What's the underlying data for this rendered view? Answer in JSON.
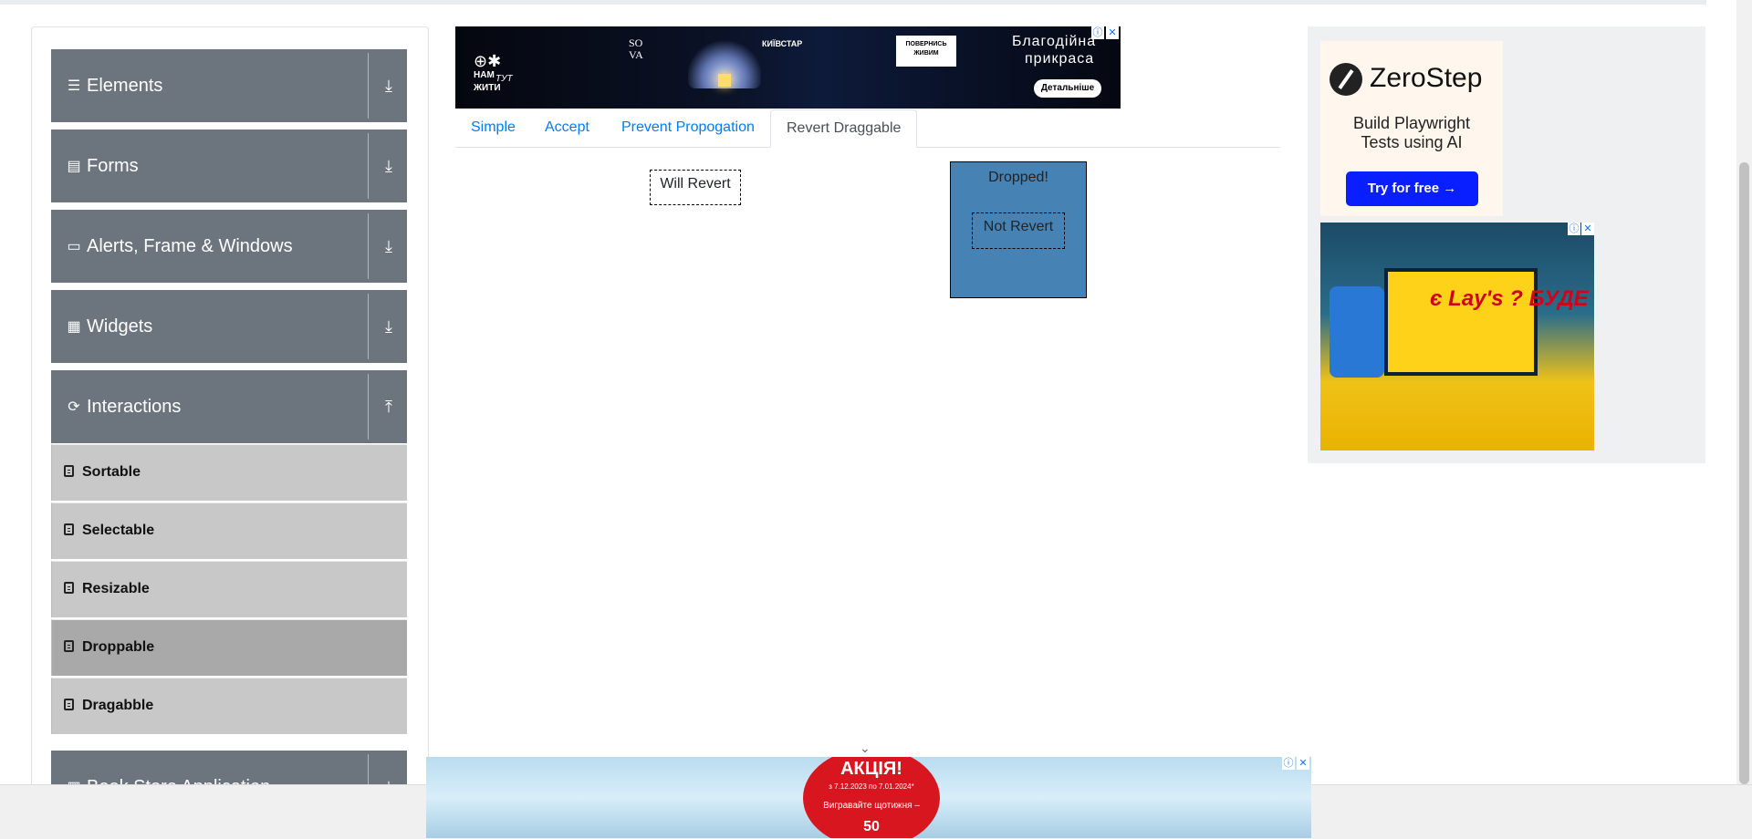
{
  "sidebar": {
    "groups": [
      {
        "label": "Elements",
        "icon": "hamburger-icon",
        "arrow": "download-icon"
      },
      {
        "label": "Forms",
        "icon": "file-icon",
        "arrow": "download-icon"
      },
      {
        "label": "Alerts, Frame & Windows",
        "icon": "window-icon",
        "arrow": "download-icon"
      },
      {
        "label": "Widgets",
        "icon": "widgets-grid-icon",
        "arrow": "download-icon"
      },
      {
        "label": "Interactions",
        "icon": "refresh-icon",
        "arrow": "upload-icon"
      },
      {
        "label": "Book Store Application",
        "icon": "book-icon",
        "arrow": "download-icon"
      }
    ],
    "interactions_items": [
      {
        "label": "Sortable",
        "active": false
      },
      {
        "label": "Selectable",
        "active": false
      },
      {
        "label": "Resizable",
        "active": false
      },
      {
        "label": "Droppable",
        "active": true
      },
      {
        "label": "Dragabble",
        "active": false
      }
    ]
  },
  "tabs": [
    {
      "label": "Simple",
      "active": false
    },
    {
      "label": "Accept",
      "active": false
    },
    {
      "label": "Prevent Propogation",
      "active": false
    },
    {
      "label": "Revert Draggable",
      "active": true
    }
  ],
  "revert_demo": {
    "will_revert": "Will Revert",
    "drop_label": "Dropped!",
    "not_revert": "Not Revert",
    "drop_color": "#4682b4"
  },
  "ad_top": {
    "brand": "SO VA",
    "operator": "КИЇВСТАР",
    "badge": "ПОВЕРНИСЬ ЖИВИМ",
    "headline_1": "Благодійна",
    "headline_2": "прикраса",
    "cta": "Детальніше",
    "logo_1": "НАМ",
    "logo_2": "ТУТ",
    "logo_3": "ЖИТИ"
  },
  "ad_right": {
    "brand": "ZeroStep",
    "subtitle_1": "Build Playwright",
    "subtitle_2": "Tests using AI",
    "cta": "Try for free →",
    "lays_text": "є Lay's ? БУДЕ КІНО!"
  },
  "ad_bottom": {
    "promo_title": "АКЦІЯ!",
    "promo_dates": "з 7.12.2023 по 7.01.2024*",
    "promo_text": "Вигравайте щотижня –",
    "promo_number": "50"
  },
  "colors": {
    "accordion_header": "#6c757d",
    "menu_item": "#c8c8c8",
    "menu_item_active": "#a9a9a9",
    "link": "#007bff"
  }
}
